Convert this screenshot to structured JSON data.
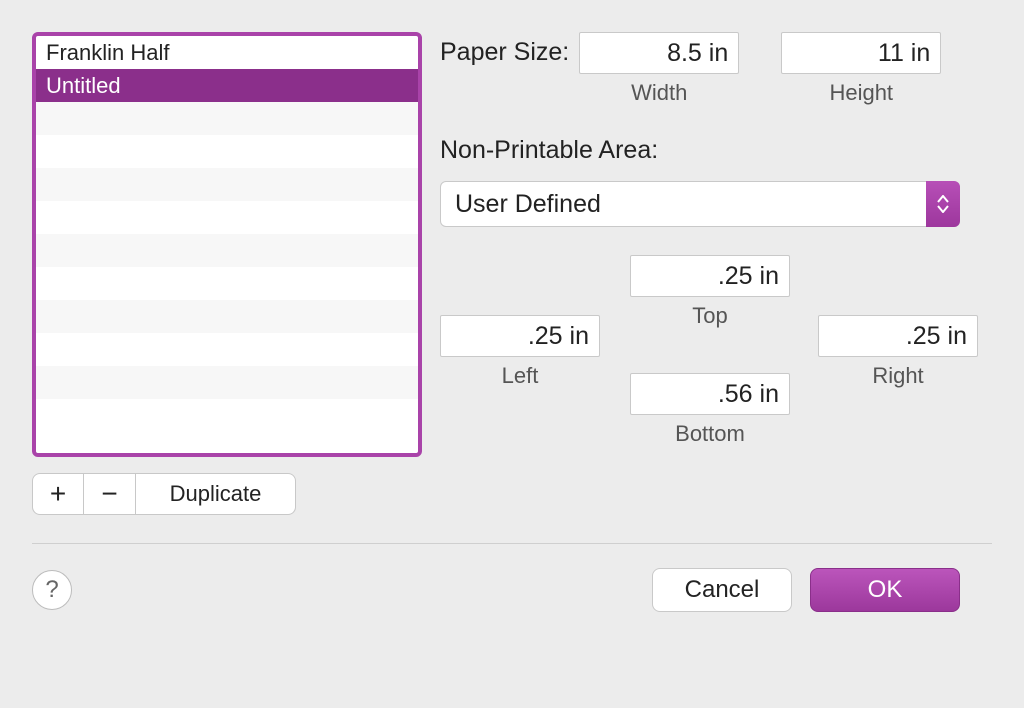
{
  "sidebar": {
    "items": [
      {
        "label": "Franklin Half",
        "selected": false
      },
      {
        "label": "Untitled",
        "selected": true
      }
    ]
  },
  "list_buttons": {
    "add": "+",
    "remove": "−",
    "duplicate": "Duplicate"
  },
  "paper_size": {
    "label": "Paper Size:",
    "width_value": "8.5 in",
    "width_caption": "Width",
    "height_value": "11 in",
    "height_caption": "Height"
  },
  "non_printable": {
    "label": "Non-Printable Area:",
    "dropdown_value": "User Defined",
    "top": {
      "value": ".25 in",
      "caption": "Top"
    },
    "left": {
      "value": ".25 in",
      "caption": "Left"
    },
    "right": {
      "value": ".25 in",
      "caption": "Right"
    },
    "bottom": {
      "value": ".56 in",
      "caption": "Bottom"
    }
  },
  "footer": {
    "help": "?",
    "cancel": "Cancel",
    "ok": "OK"
  }
}
